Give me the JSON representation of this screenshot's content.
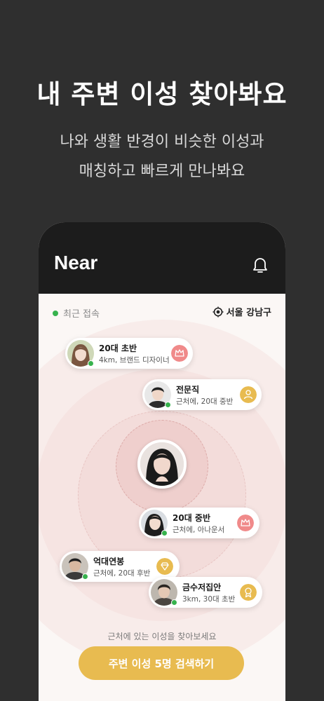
{
  "promo": {
    "title": "내 주변 이성 찾아봐요",
    "subtitle_line1": "나와 생활 반경이 비슷한 이성과",
    "subtitle_line2": "매칭하고 빠르게 만나봐요"
  },
  "app": {
    "title": "Near",
    "header_icon": "bell-icon",
    "status_label": "최근 접속",
    "location": "서울 강남구",
    "location_icon": "location-target-icon",
    "hint": "근처에 있는 이성을 찾아보세요",
    "cta_label": "주변 이성 5명 검색하기"
  },
  "profiles": [
    {
      "title": "20대 초반",
      "sub": "4km, 브랜드 디자이너",
      "badge": "crown-icon"
    },
    {
      "title": "전문직",
      "sub": "근처에, 20대 중반",
      "badge": "professional-icon"
    },
    {
      "title": "20대 중반",
      "sub": "근처에, 아나운서",
      "badge": "crown-icon"
    },
    {
      "title": "억대연봉",
      "sub": "근처에, 20대 후반",
      "badge": "diamond-icon"
    },
    {
      "title": "금수저집안",
      "sub": "3km, 30대 초반",
      "badge": "gold-medal-icon"
    }
  ],
  "colors": {
    "background": "#2f2f2f",
    "header": "#1c1c1c",
    "accent_gold": "#e8bb50",
    "online_green": "#37b24d",
    "crown_badge": "#f08a8a"
  }
}
